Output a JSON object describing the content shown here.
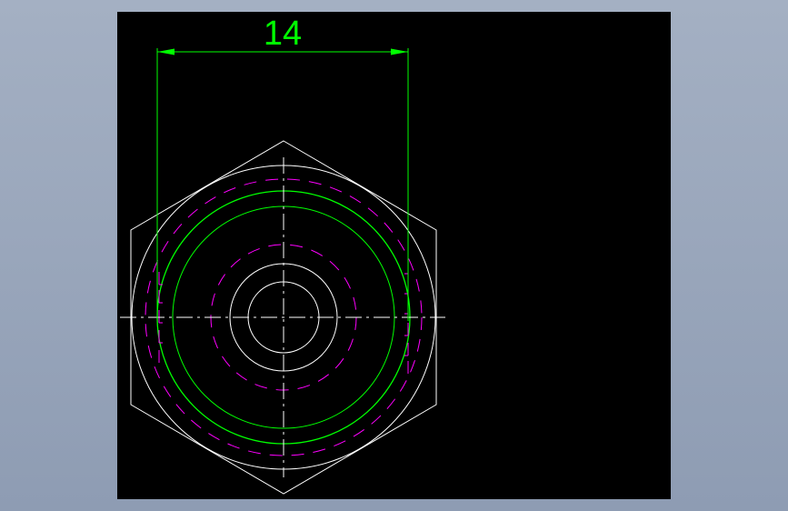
{
  "drawing": {
    "dimension_label": "14"
  },
  "colors": {
    "background": "#000000",
    "outline": "#ffffff",
    "dimension": "#00ff00",
    "hidden_line": "#ff00ff",
    "centerline": "#ffffff"
  }
}
